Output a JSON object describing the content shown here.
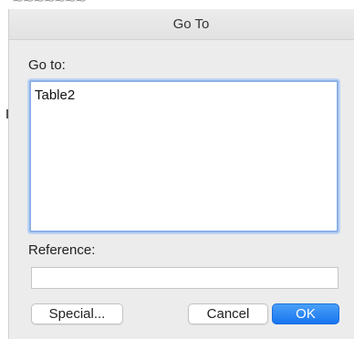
{
  "dialog": {
    "title": "Go To",
    "goto_label": "Go to:",
    "goto_items": [
      "Table2"
    ],
    "reference_label": "Reference:",
    "reference_value": "",
    "buttons": {
      "special": "Special...",
      "cancel": "Cancel",
      "ok": "OK"
    }
  },
  "colors": {
    "accent": "#1a7bf2",
    "focus_ring": "#8cb1e6",
    "dialog_bg": "#ececec"
  }
}
